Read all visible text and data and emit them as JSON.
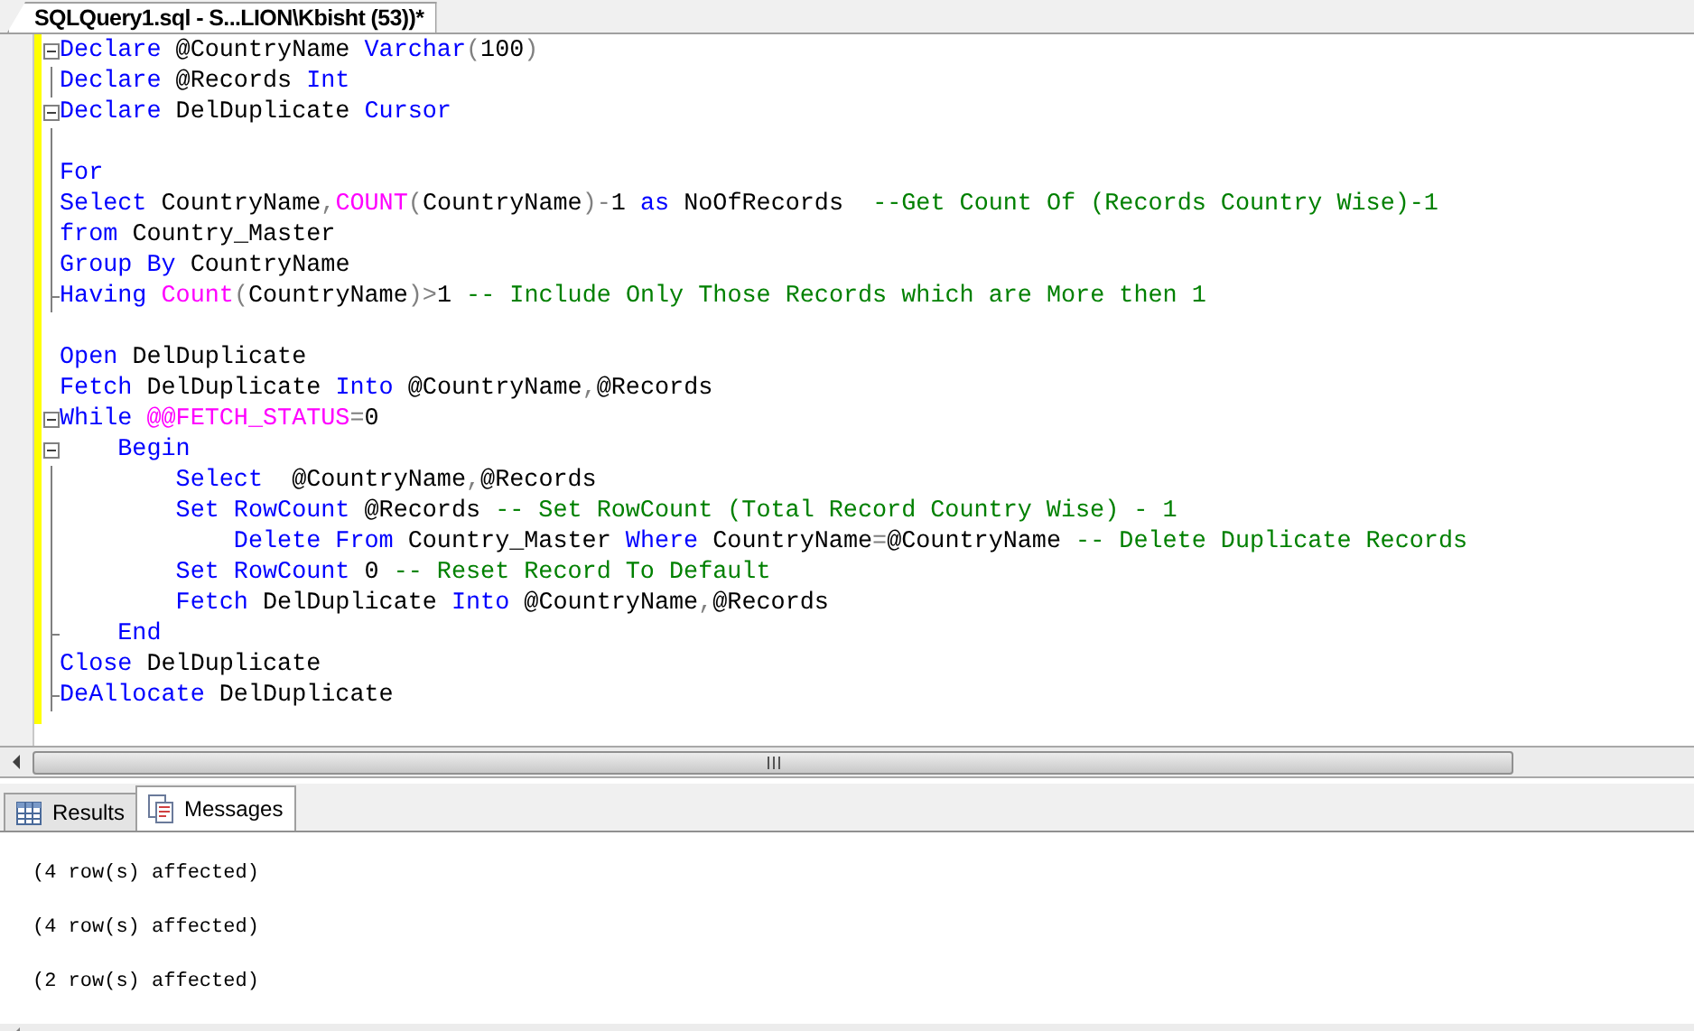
{
  "document_tab": {
    "title": "SQLQuery1.sql - S...LION\\Kbisht (53))*",
    "selected": true
  },
  "editor": {
    "lines": [
      {
        "kind": "fold-start",
        "tokens": [
          {
            "kind": "kw",
            "text": "Declare"
          },
          {
            "kind": "tx",
            "text": " @CountryName "
          },
          {
            "kind": "kw",
            "text": "Varchar"
          },
          {
            "kind": "op",
            "text": "("
          },
          {
            "kind": "tx",
            "text": "100"
          },
          {
            "kind": "op",
            "text": ")"
          }
        ]
      },
      {
        "kind": "fold-body",
        "tokens": [
          {
            "kind": "kw",
            "text": "Declare"
          },
          {
            "kind": "tx",
            "text": " @Records "
          },
          {
            "kind": "kw",
            "text": "Int"
          }
        ]
      },
      {
        "kind": "fold-start",
        "tokens": [
          {
            "kind": "kw",
            "text": "Declare"
          },
          {
            "kind": "tx",
            "text": " DelDuplicate "
          },
          {
            "kind": "kw",
            "text": "Cursor"
          }
        ]
      },
      {
        "kind": "fold-body"
      },
      {
        "kind": "fold-body",
        "tokens": [
          {
            "kind": "kw",
            "text": "For"
          }
        ]
      },
      {
        "kind": "fold-body",
        "tokens": [
          {
            "kind": "kw",
            "text": "Select"
          },
          {
            "kind": "tx",
            "text": " CountryName"
          },
          {
            "kind": "op",
            "text": ","
          },
          {
            "kind": "fn",
            "text": "COUNT"
          },
          {
            "kind": "op",
            "text": "("
          },
          {
            "kind": "tx",
            "text": "CountryName"
          },
          {
            "kind": "op",
            "text": ")-"
          },
          {
            "kind": "tx",
            "text": "1 "
          },
          {
            "kind": "kw",
            "text": "as"
          },
          {
            "kind": "tx",
            "text": " NoOfRecords  "
          },
          {
            "kind": "cm",
            "text": "--Get Count Of (Records Country Wise)-1"
          }
        ]
      },
      {
        "kind": "fold-body",
        "tokens": [
          {
            "kind": "kw",
            "text": "from"
          },
          {
            "kind": "tx",
            "text": " Country_Master"
          }
        ]
      },
      {
        "kind": "fold-body",
        "tokens": [
          {
            "kind": "kw",
            "text": "Group By"
          },
          {
            "kind": "tx",
            "text": " CountryName"
          }
        ]
      },
      {
        "kind": "fold-end",
        "tokens": [
          {
            "kind": "kw",
            "text": "Having "
          },
          {
            "kind": "fn",
            "text": "Count"
          },
          {
            "kind": "op",
            "text": "("
          },
          {
            "kind": "tx",
            "text": "CountryName"
          },
          {
            "kind": "op",
            "text": ")>"
          },
          {
            "kind": "tx",
            "text": "1 "
          },
          {
            "kind": "cm",
            "text": "-- Include Only Those Records which are More then 1"
          }
        ]
      },
      {
        "kind": "plain"
      },
      {
        "kind": "plain",
        "tokens": [
          {
            "kind": "kw",
            "text": "Open"
          },
          {
            "kind": "tx",
            "text": " DelDuplicate"
          }
        ]
      },
      {
        "kind": "plain",
        "tokens": [
          {
            "kind": "kw",
            "text": "Fetch"
          },
          {
            "kind": "tx",
            "text": " DelDuplicate "
          },
          {
            "kind": "kw",
            "text": "Into"
          },
          {
            "kind": "tx",
            "text": " @CountryName"
          },
          {
            "kind": "op",
            "text": ","
          },
          {
            "kind": "tx",
            "text": "@Records"
          }
        ]
      },
      {
        "kind": "fold-start",
        "tokens": [
          {
            "kind": "kw",
            "text": "While "
          },
          {
            "kind": "fn",
            "text": "@@FETCH_STATUS"
          },
          {
            "kind": "op",
            "text": "="
          },
          {
            "kind": "tx",
            "text": "0"
          }
        ]
      },
      {
        "kind": "fold-start",
        "tokens": [
          {
            "kind": "kw",
            "text": "    Begin"
          }
        ]
      },
      {
        "kind": "fold-body",
        "tokens": [
          {
            "kind": "kw",
            "text": "        Select"
          },
          {
            "kind": "tx",
            "text": "  @CountryName"
          },
          {
            "kind": "op",
            "text": ","
          },
          {
            "kind": "tx",
            "text": "@Records"
          }
        ]
      },
      {
        "kind": "fold-body",
        "tokens": [
          {
            "kind": "kw",
            "text": "        Set RowCount"
          },
          {
            "kind": "tx",
            "text": " @Records "
          },
          {
            "kind": "cm",
            "text": "-- Set RowCount (Total Record Country Wise) - 1"
          }
        ]
      },
      {
        "kind": "fold-body",
        "tokens": [
          {
            "kind": "kw",
            "text": "            Delete From"
          },
          {
            "kind": "tx",
            "text": " Country_Master "
          },
          {
            "kind": "kw",
            "text": "Where"
          },
          {
            "kind": "tx",
            "text": " CountryName"
          },
          {
            "kind": "op",
            "text": "="
          },
          {
            "kind": "tx",
            "text": "@CountryName "
          },
          {
            "kind": "cm",
            "text": "-- Delete Duplicate Records"
          }
        ]
      },
      {
        "kind": "fold-body",
        "tokens": [
          {
            "kind": "kw",
            "text": "        Set RowCount"
          },
          {
            "kind": "tx",
            "text": " 0 "
          },
          {
            "kind": "cm",
            "text": "-- Reset Record To Default"
          }
        ]
      },
      {
        "kind": "fold-body",
        "tokens": [
          {
            "kind": "kw",
            "text": "        Fetch"
          },
          {
            "kind": "tx",
            "text": " DelDuplicate "
          },
          {
            "kind": "kw",
            "text": "Into"
          },
          {
            "kind": "tx",
            "text": " @CountryName"
          },
          {
            "kind": "op",
            "text": ","
          },
          {
            "kind": "tx",
            "text": "@Records"
          }
        ]
      },
      {
        "kind": "fold-end",
        "tokens": [
          {
            "kind": "kw",
            "text": "    End"
          }
        ]
      },
      {
        "kind": "fold-body",
        "tokens": [
          {
            "kind": "kw",
            "text": "Close"
          },
          {
            "kind": "tx",
            "text": " DelDuplicate"
          }
        ]
      },
      {
        "kind": "fold-end",
        "tokens": [
          {
            "kind": "kw",
            "text": "DeAllocate"
          },
          {
            "kind": "tx",
            "text": " DelDuplicate"
          }
        ]
      }
    ]
  },
  "result_tabs": [
    {
      "label": "Results",
      "kind": "grid",
      "selected": false
    },
    {
      "label": "Messages",
      "kind": "messages",
      "selected": true
    }
  ],
  "messages": [
    "(4 row(s) affected)",
    "(4 row(s) affected)",
    "(2 row(s) affected)"
  ]
}
